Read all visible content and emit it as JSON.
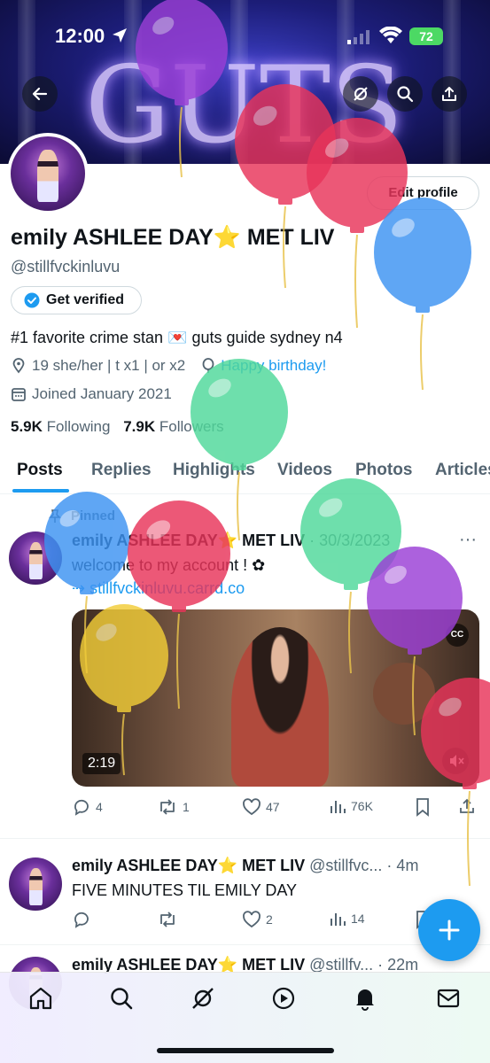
{
  "status": {
    "time": "12:00",
    "battery": "72"
  },
  "banner": {
    "text": "GUTS"
  },
  "profile": {
    "edit_label": "Edit profile",
    "display_name": "emily ASHLEE DAY⭐ MET LIV",
    "handle": "@stillfvckinluvu",
    "verify_label": "Get verified",
    "bio": "#1 favorite crime stan 💌 guts guide sydney n4",
    "location": "19 she/her | t x1 | or x2",
    "birthday_link": "Happy birthday!",
    "joined": "Joined January 2021",
    "following_count": "5.9K",
    "following_label": "Following",
    "followers_count": "7.9K",
    "followers_label": "Followers"
  },
  "tabs": [
    "Posts",
    "Replies",
    "Highlights",
    "Videos",
    "Photos",
    "Articles"
  ],
  "posts": [
    {
      "pinned_label": "Pinned",
      "name": "emily ASHLEE DAY⭐ MET LIV",
      "meta": "· 30/3/2023",
      "text": "welcome to my account ! ✿",
      "link": "⇢ stillfvckinluvu.carrd.co",
      "media": {
        "duration": "2:19",
        "cc": "CC"
      },
      "replies": "4",
      "reposts": "1",
      "likes": "47",
      "views": "76K"
    },
    {
      "name": "emily ASHLEE DAY⭐ MET LIV",
      "meta": "@stillfvc... · 4m",
      "text": "FIVE MINUTES TIL EMILY DAY",
      "replies": "",
      "reposts": "",
      "likes": "2",
      "views": "14"
    },
    {
      "name": "emily ASHLEE DAY⭐ MET LIV",
      "meta": "@stillfv... · 22m"
    }
  ],
  "colors": {
    "accent": "#1d9bf0",
    "balloon_purple": "#9b3fd6",
    "balloon_red": "#e8345a",
    "balloon_blue": "#3d93f2",
    "balloon_green": "#4fd89a",
    "balloon_yellow": "#f2cd38"
  },
  "icons": [
    "back-arrow-icon",
    "grok-icon",
    "search-icon",
    "share-icon",
    "home-icon",
    "explore-icon",
    "grok-nav-icon",
    "video-icon",
    "notifications-icon",
    "messages-icon"
  ]
}
